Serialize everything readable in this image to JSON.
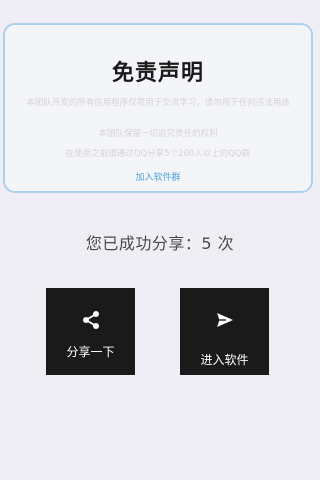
{
  "disclaimer": {
    "title": "免责声明",
    "lines": [
      "本团队开发的所有应用程序仅限用于交流学习，请勿用于任何违法用途",
      "本团队保留一切追究责任的权利",
      "在使用之前请通过QQ分享5个200人以上的QQ群"
    ],
    "join_link": "加入软件群"
  },
  "share_status": "您已成功分享：5 次",
  "actions": {
    "share": {
      "label": "分享一下",
      "icon": "share-icon"
    },
    "enter": {
      "label": "进入软件",
      "icon": "send-icon"
    }
  },
  "colors": {
    "background": "#efeef4",
    "card_border": "#a9d2ee",
    "link": "#4aa3df",
    "tile": "#1a1a1a"
  }
}
